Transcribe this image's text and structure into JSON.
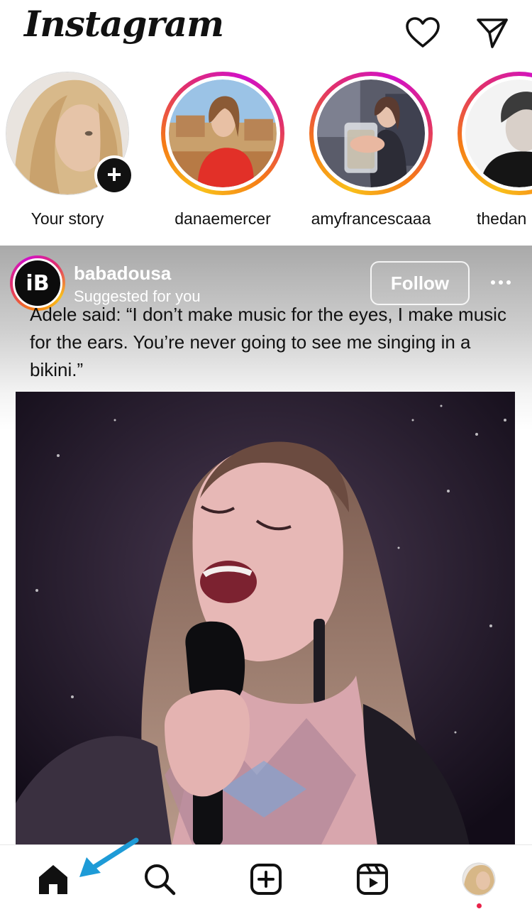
{
  "app": {
    "title": "Instagram",
    "accent_colors": [
      "#f9c01a",
      "#f57b16",
      "#e1306c",
      "#d110c9"
    ]
  },
  "header": {
    "logo_text": "Instagram",
    "icons": [
      "heart-icon",
      "direct-message-icon"
    ]
  },
  "stories": [
    {
      "name": "Your story",
      "own": true
    },
    {
      "name": "danaemercer",
      "own": false
    },
    {
      "name": "amyfrancescaaa",
      "own": false
    },
    {
      "name": "thedan",
      "own": false
    }
  ],
  "post": {
    "username": "babadousa",
    "subtitle": "Suggested for you",
    "follow_label": "Follow",
    "avatar_letter": "iB",
    "caption": "Adele said: “I don’t make music for the eyes, I make music for the ears. You’re never going to see me singing in a bikini.”"
  },
  "bottom_nav": {
    "items": [
      "home-icon",
      "search-icon",
      "create-post-icon",
      "reels-icon",
      "profile-avatar"
    ],
    "notification_color": "#e8234a"
  },
  "annotation": {
    "arrow_color": "#1e9bd7"
  }
}
